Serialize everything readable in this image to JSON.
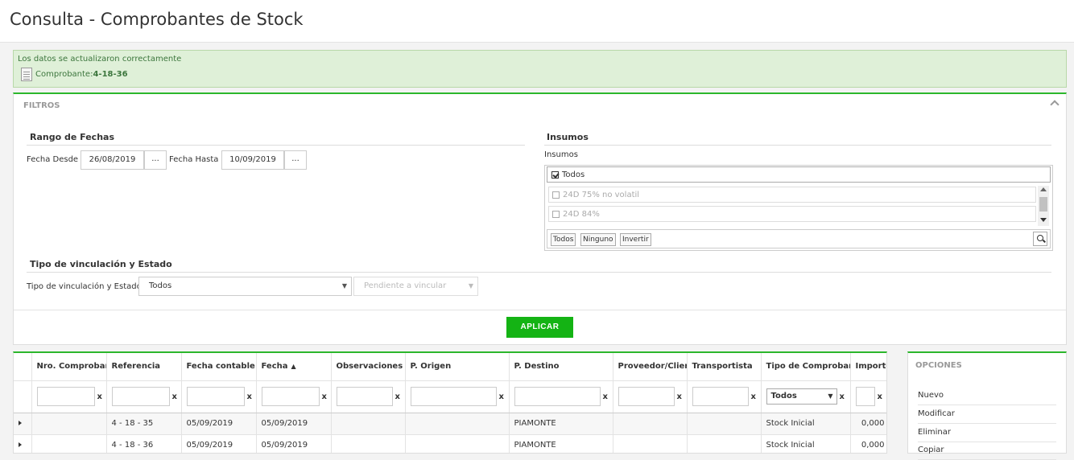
{
  "page": {
    "title": "Consulta - Comprobantes de Stock"
  },
  "alert": {
    "message": "Los datos se actualizaron correctamente",
    "doc_label": "Comprobante:",
    "doc_value": "4-18-36"
  },
  "filters": {
    "header": "FILTROS",
    "dates": {
      "title": "Rango de Fechas",
      "from_label": "Fecha Desde",
      "from_value": "26/08/2019",
      "to_label": "Fecha Hasta",
      "to_value": "10/09/2019",
      "picker_label": "..."
    },
    "insumos": {
      "title": "Insumos",
      "label": "Insumos",
      "all_label": "Todos",
      "items": [
        "24D 75% no volatil",
        "24D 84%"
      ],
      "buttons": {
        "todos": "Todos",
        "ninguno": "Ninguno",
        "invertir": "Invertir"
      }
    },
    "vinculacion": {
      "title": "Tipo de vinculación y Estado",
      "label": "Tipo de vinculación y Estado",
      "tipo_value": "Todos",
      "estado_placeholder": "Pendiente a vincular"
    },
    "apply_label": "APLICAR"
  },
  "grid": {
    "columns": [
      "Nro. Comprobante",
      "Referencia",
      "Fecha contable",
      "Fecha",
      "Observaciones",
      "P. Origen",
      "P. Destino",
      "Proveedor/Cliente",
      "Transportista",
      "Tipo de Comprobante",
      "Importe"
    ],
    "clear_label": "x",
    "tipo_filter_value": "Todos",
    "rows": [
      {
        "nro": "",
        "referencia": "4 - 18 - 35",
        "fecha_contable": "05/09/2019",
        "fecha": "05/09/2019",
        "observaciones": "",
        "p_origen": "",
        "p_destino": "PIAMONTE",
        "proveedor": "",
        "transportista": "",
        "tipo": "Stock Inicial",
        "importe": "0,000"
      },
      {
        "nro": "",
        "referencia": "4 - 18 - 36",
        "fecha_contable": "05/09/2019",
        "fecha": "05/09/2019",
        "observaciones": "",
        "p_origen": "",
        "p_destino": "PIAMONTE",
        "proveedor": "",
        "transportista": "",
        "tipo": "Stock Inicial",
        "importe": "0,000"
      }
    ]
  },
  "opciones": {
    "header": "OPCIONES",
    "items": [
      "Nuevo",
      "Modificar",
      "Eliminar",
      "Copiar"
    ]
  },
  "colors": {
    "accent": "#2cb72c",
    "button": "#14b314",
    "alert_bg": "#dff0d8",
    "alert_text": "#3c763d"
  }
}
